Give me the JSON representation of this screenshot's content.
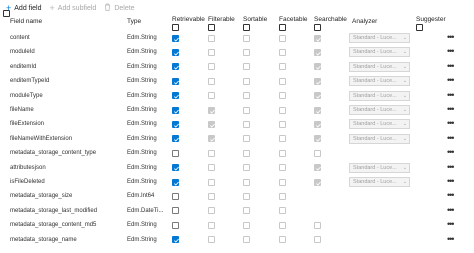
{
  "toolbar": {
    "add_field": "Add field",
    "add_subfield": "Add subfield",
    "delete": "Delete"
  },
  "headers": {
    "field_name": "Field name",
    "type": "Type",
    "retrievable": "Retrievable",
    "filterable": "Filterable",
    "sortable": "Sortable",
    "facetable": "Facetable",
    "searchable": "Searchable",
    "analyzer": "Analyzer",
    "suggester": "Suggester"
  },
  "analyzer_placeholder": "Standard - Luce...",
  "more_glyph": "•••",
  "rows": [
    {
      "name": "content",
      "type": "Edm.String",
      "retrievable": "checked",
      "filterable": "disabled",
      "sortable": "disabled",
      "facetable": "disabled",
      "searchable": "disabled-checked",
      "analyzer": true
    },
    {
      "name": "moduleId",
      "type": "Edm.String",
      "retrievable": "checked",
      "filterable": "disabled",
      "sortable": "disabled",
      "facetable": "disabled",
      "searchable": "disabled-checked",
      "analyzer": true
    },
    {
      "name": "enditemId",
      "type": "Edm.String",
      "retrievable": "checked",
      "filterable": "disabled",
      "sortable": "disabled",
      "facetable": "disabled",
      "searchable": "disabled-checked",
      "analyzer": true
    },
    {
      "name": "enditemTypeId",
      "type": "Edm.String",
      "retrievable": "checked",
      "filterable": "disabled",
      "sortable": "disabled",
      "facetable": "disabled",
      "searchable": "disabled-checked",
      "analyzer": true
    },
    {
      "name": "moduleType",
      "type": "Edm.String",
      "retrievable": "checked",
      "filterable": "disabled",
      "sortable": "disabled",
      "facetable": "disabled",
      "searchable": "disabled-checked",
      "analyzer": true
    },
    {
      "name": "fileName",
      "type": "Edm.String",
      "retrievable": "checked",
      "filterable": "disabled-checked",
      "sortable": "disabled",
      "facetable": "disabled",
      "searchable": "disabled-checked",
      "analyzer": true
    },
    {
      "name": "fileExtension",
      "type": "Edm.String",
      "retrievable": "checked",
      "filterable": "disabled-checked",
      "sortable": "disabled",
      "facetable": "disabled",
      "searchable": "disabled-checked",
      "analyzer": true
    },
    {
      "name": "fileNameWithExtension",
      "type": "Edm.String",
      "retrievable": "checked",
      "filterable": "disabled-checked",
      "sortable": "disabled",
      "facetable": "disabled",
      "searchable": "disabled-checked",
      "analyzer": true
    },
    {
      "name": "metadata_storage_content_type",
      "type": "Edm.String",
      "retrievable": "empty",
      "filterable": "disabled",
      "sortable": "disabled",
      "facetable": "disabled",
      "searchable": "disabled",
      "analyzer": false
    },
    {
      "name": "attributesjson",
      "type": "Edm.String",
      "retrievable": "checked",
      "filterable": "disabled",
      "sortable": "disabled",
      "facetable": "disabled",
      "searchable": "disabled-checked",
      "analyzer": true
    },
    {
      "name": "isFileDeleted",
      "type": "Edm.String",
      "retrievable": "checked",
      "filterable": "disabled",
      "sortable": "disabled",
      "facetable": "disabled",
      "searchable": "disabled-checked",
      "analyzer": true
    },
    {
      "name": "metadata_storage_size",
      "type": "Edm.Int64",
      "retrievable": "empty",
      "filterable": "disabled",
      "sortable": "disabled",
      "facetable": "disabled",
      "searchable": "none",
      "analyzer": false
    },
    {
      "name": "metadata_storage_last_modified",
      "type": "Edm.DateTi...",
      "retrievable": "empty",
      "filterable": "disabled",
      "sortable": "disabled",
      "facetable": "disabled",
      "searchable": "none",
      "analyzer": false
    },
    {
      "name": "metadata_storage_content_md5",
      "type": "Edm.String",
      "retrievable": "empty",
      "filterable": "disabled",
      "sortable": "disabled",
      "facetable": "disabled",
      "searchable": "disabled",
      "analyzer": false
    },
    {
      "name": "metadata_storage_name",
      "type": "Edm.String",
      "retrievable": "checked",
      "filterable": "disabled",
      "sortable": "disabled",
      "facetable": "disabled",
      "searchable": "disabled",
      "analyzer": false
    }
  ]
}
